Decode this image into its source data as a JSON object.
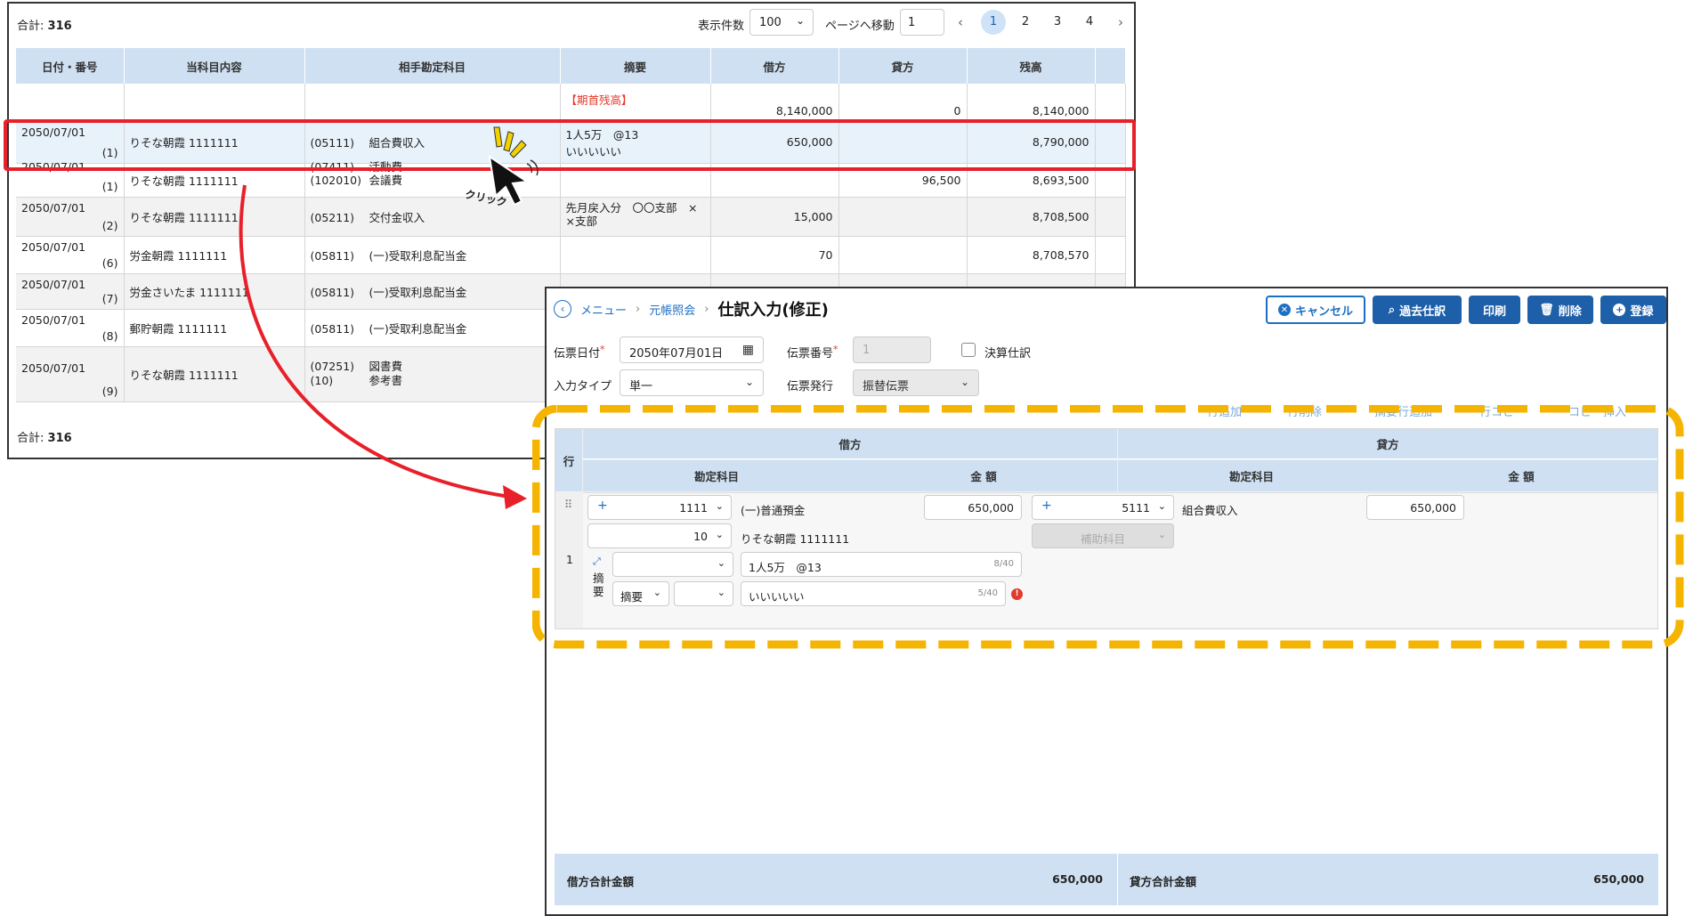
{
  "ledger": {
    "total_top": "合計:",
    "total_value": "316",
    "per_page_label": "表示件数",
    "per_page_value": "100",
    "goto_label": "ページへ移動",
    "goto_value": "1",
    "pages": [
      "1",
      "2",
      "3",
      "4"
    ],
    "columns": [
      "日付・番号",
      "当科目内容",
      "相手勘定科目",
      "摘要",
      "借方",
      "貸方",
      "残高"
    ],
    "opening": {
      "summary": "【期首残高】",
      "debit": "8,140,000",
      "credit": "0",
      "balance": "8,140,000"
    },
    "rows": [
      {
        "date": "2050/07/01",
        "no": "(1)",
        "account": "りそな朝霞 1111111",
        "codes": [
          "(05111)"
        ],
        "names": [
          "組合費収入"
        ],
        "summary": [
          "1人5万　@13",
          "いいいいい"
        ],
        "debit": "650,000",
        "credit": "",
        "balance": "8,790,000"
      },
      {
        "date": "2050/07/01",
        "no": "(1)",
        "account": "りそな朝霞 1111111",
        "codes": [
          "(07411)",
          "(102010)"
        ],
        "names": [
          "活動費",
          "会議費"
        ],
        "summary": [],
        "debit": "",
        "credit": "96,500",
        "balance": "8,693,500"
      },
      {
        "date": "2050/07/01",
        "no": "(2)",
        "account": "りそな朝霞 1111111",
        "codes": [
          "(05211)"
        ],
        "names": [
          "交付金収入"
        ],
        "summary": [
          "先月戻入分　〇〇支部　×",
          "×支部"
        ],
        "debit": "15,000",
        "credit": "",
        "balance": "8,708,500"
      },
      {
        "date": "2050/07/01",
        "no": "(6)",
        "account": "労金朝霞 1111111",
        "codes": [
          "(05811)"
        ],
        "names": [
          "(一)受取利息配当金"
        ],
        "summary": [],
        "debit": "70",
        "credit": "",
        "balance": "8,708,570"
      },
      {
        "date": "2050/07/01",
        "no": "(7)",
        "account": "労金さいたま 1111111",
        "codes": [
          "(05811)"
        ],
        "names": [
          "(一)受取利息配当金"
        ],
        "summary": [],
        "debit": "",
        "credit": "",
        "balance": ""
      },
      {
        "date": "2050/07/01",
        "no": "(8)",
        "account": "郵貯朝霞 1111111",
        "codes": [
          "(05811)"
        ],
        "names": [
          "(一)受取利息配当金"
        ],
        "summary": [],
        "debit": "",
        "credit": "",
        "balance": ""
      },
      {
        "date": "2050/07/01",
        "no": "(9)",
        "account": "りそな朝霞 1111111",
        "codes": [
          "(07251)",
          "(10)"
        ],
        "names": [
          "図書費",
          "参考書"
        ],
        "summary": [],
        "debit": "",
        "credit": "",
        "balance": ""
      }
    ],
    "total_bottom": "合計:",
    "total_bottom_value": "316"
  },
  "click_label": "クリック",
  "journal": {
    "breadcrumb": [
      "メニュー",
      "元帳照会"
    ],
    "title": "仕訳入力(修正)",
    "buttons": {
      "cancel": "キャンセル",
      "history": "過去仕訳",
      "print": "印刷",
      "delete": "削除",
      "register": "登録"
    },
    "form": {
      "date_label": "伝票日付",
      "date_value": "2050年07月01日",
      "number_label": "伝票番号",
      "number_value": "1",
      "closing_label": "決算仕訳",
      "input_type_label": "入力タイプ",
      "input_type_value": "単一",
      "issue_label": "伝票発行",
      "issue_value": "振替伝票"
    },
    "row_actions": [
      "行追加",
      "行削除",
      "摘要行追加",
      "行コピー",
      "コピー挿入"
    ],
    "grid": {
      "row_header": "行",
      "debit_header": "借方",
      "credit_header": "貸方",
      "account_header": "勘定科目",
      "amount_header": "金 額",
      "row_no": "1",
      "debit_code": "1111",
      "debit_name": "(一)普通預金",
      "debit_amount": "650,000",
      "debit_sub_code": "10",
      "debit_sub_name": "りそな朝霞 1111111",
      "credit_code": "5111",
      "credit_name": "組合費収入",
      "credit_amount": "650,000",
      "credit_sub_placeholder": "補助科目",
      "summary_label": "摘要",
      "summary_type": "摘要",
      "summary1": "1人5万　@13",
      "summary1_count": "8/40",
      "summary2": "いいいいい",
      "summary2_count": "5/40"
    },
    "footer": {
      "debit_total_label": "借方合計金額",
      "debit_total": "650,000",
      "credit_total_label": "貸方合計金額",
      "credit_total": "650,000"
    }
  },
  "colors": {
    "highlight": "#e8202a",
    "dashed": "#f5b400",
    "accent": "#1d5fa8",
    "header": "#cfe0f3"
  }
}
